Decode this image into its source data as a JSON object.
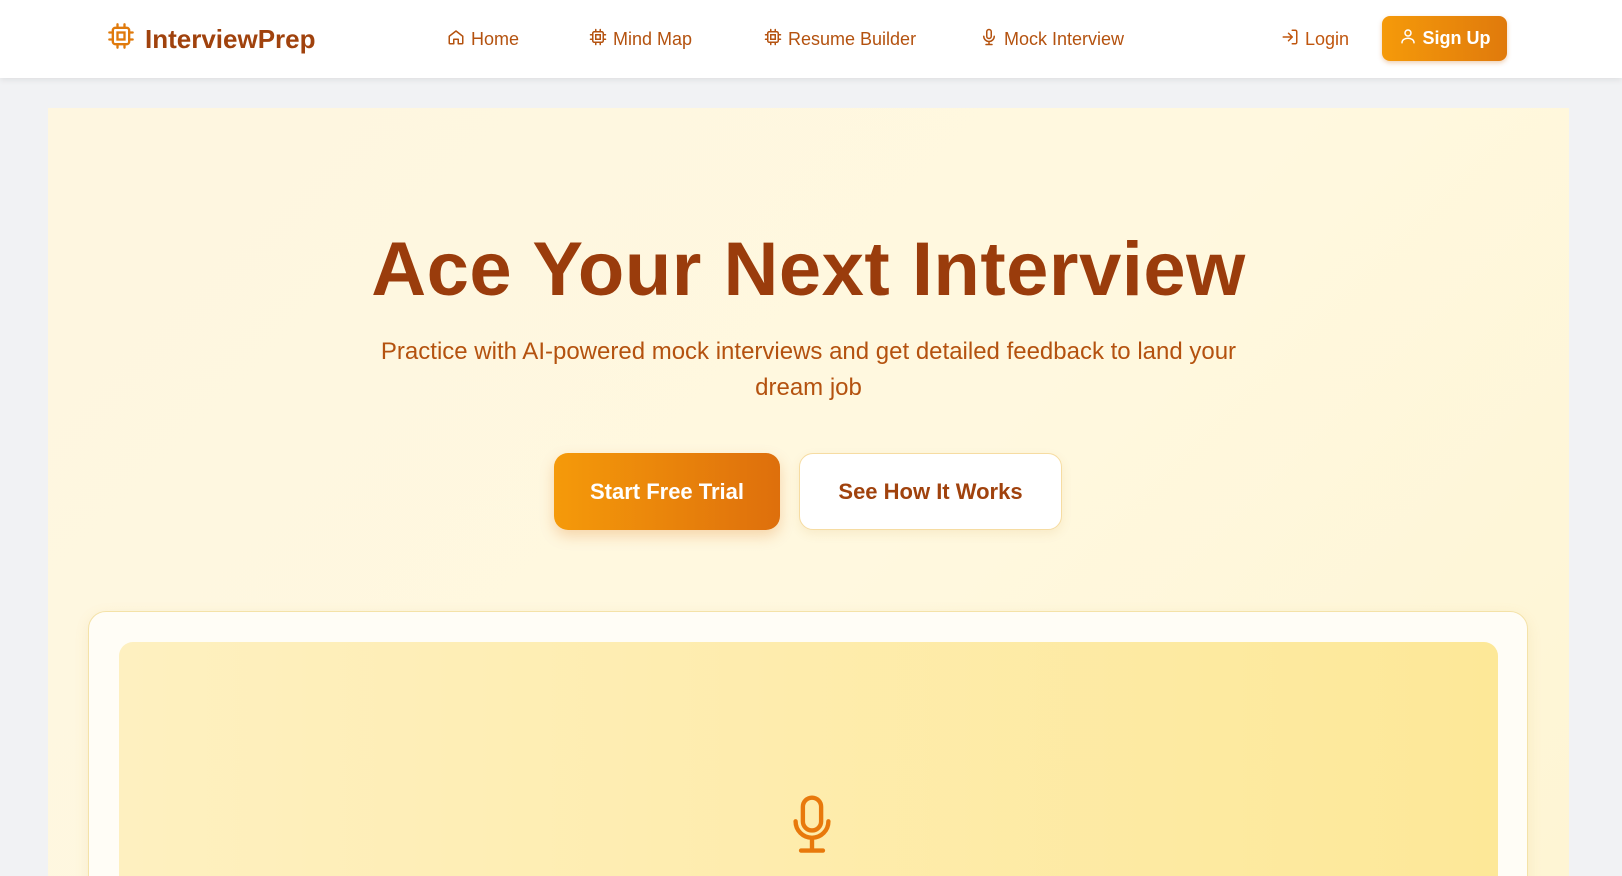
{
  "brand": {
    "name": "InterviewPrep",
    "icon": "chip-icon"
  },
  "nav": {
    "links": [
      {
        "label": "Home",
        "icon": "home-icon"
      },
      {
        "label": "Mind Map",
        "icon": "chip-icon"
      },
      {
        "label": "Resume Builder",
        "icon": "chip-icon"
      },
      {
        "label": "Mock Interview",
        "icon": "microphone-icon"
      }
    ],
    "login_label": "Login",
    "signup_label": "Sign Up"
  },
  "hero": {
    "title": "Ace Your Next Interview",
    "subtitle": "Practice with AI-powered mock interviews and get detailed feedback to land your dream job",
    "primary_cta": "Start Free Trial",
    "secondary_cta": "See How It Works"
  },
  "colors": {
    "brand": "#a0420d",
    "accent": "#f59a0a",
    "hero_bg": "#fff8df"
  }
}
